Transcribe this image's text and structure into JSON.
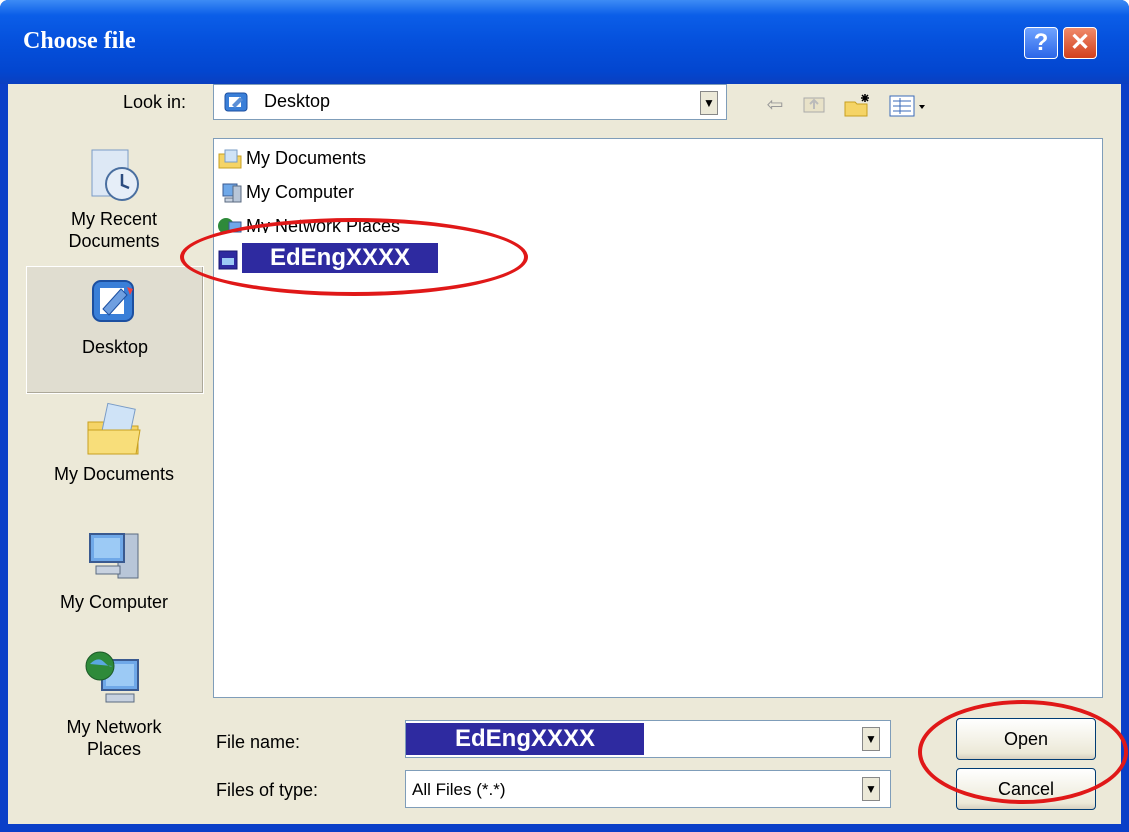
{
  "window": {
    "title": "Choose file",
    "help_icon": "?",
    "close_icon": "✕"
  },
  "lookin": {
    "label": "Look in:",
    "value": "Desktop"
  },
  "places": [
    {
      "label": "My Recent\nDocuments",
      "icon": "recent-documents-icon"
    },
    {
      "label": "Desktop",
      "icon": "desktop-icon",
      "selected": true
    },
    {
      "label": "My Documents",
      "icon": "my-documents-icon"
    },
    {
      "label": "My Computer",
      "icon": "my-computer-icon"
    },
    {
      "label": "My Network\nPlaces",
      "icon": "network-places-icon"
    }
  ],
  "files": [
    {
      "name": "My Documents",
      "icon": "folder-icon"
    },
    {
      "name": "My Computer",
      "icon": "computer-icon"
    },
    {
      "name": "My Network Places",
      "icon": "network-icon"
    },
    {
      "name": "EdEngXXXX",
      "icon": "shortcut-icon",
      "highlighted": true
    }
  ],
  "filename": {
    "label": "File name:",
    "value": "EdEngXXXX"
  },
  "filetype": {
    "label": "Files of type:",
    "value": "All Files (*.*)"
  },
  "buttons": {
    "open": "Open",
    "cancel": "Cancel"
  },
  "colors": {
    "title_bar": "#0550dc",
    "highlight": "#2e2aa0",
    "annotation": "#e01818"
  }
}
